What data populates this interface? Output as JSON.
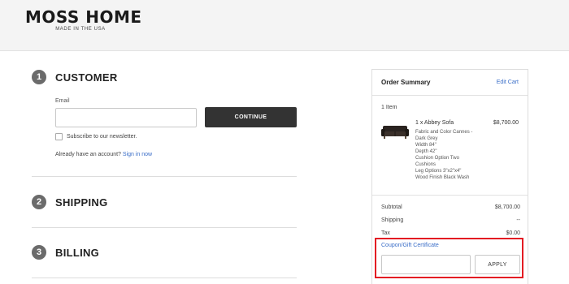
{
  "header": {
    "logo_main": "MOSS HOME",
    "logo_sub": "MADE IN THE USA"
  },
  "steps": [
    {
      "number": "1",
      "title": "CUSTOMER"
    },
    {
      "number": "2",
      "title": "SHIPPING"
    },
    {
      "number": "3",
      "title": "BILLING"
    }
  ],
  "customer": {
    "email_label": "Email",
    "email_value": "",
    "email_placeholder": "",
    "continue_label": "CONTINUE",
    "newsletter_label": "Subscribe to our newsletter.",
    "newsletter_checked": false,
    "account_prompt": "Already have an account?",
    "signin_label": "Sign in now"
  },
  "summary": {
    "title": "Order Summary",
    "edit_cart": "Edit Cart",
    "item_count": "1 Item",
    "product": {
      "name": "1 x Abbey Sofa",
      "price": "$8,700.00",
      "options": [
        "Fabric and Color Cannes -",
        "Dark Grey",
        "Width 84\"",
        "Depth 42\"",
        "Cushion Option Two",
        "Cushions",
        "Leg Options 3\"x2\"x4\"",
        "Wood Finish Black Wash"
      ]
    },
    "subtotal_label": "Subtotal",
    "subtotal_value": "$8,700.00",
    "shipping_label": "Shipping",
    "shipping_value": "--",
    "tax_label": "Tax",
    "tax_value": "$0.00",
    "coupon_link": "Coupon/Gift Certificate",
    "coupon_value": "",
    "apply_label": "APPLY"
  },
  "colors": {
    "accent_link": "#3a6ec8",
    "highlight_border": "#e31c23",
    "button_dark": "#333333"
  }
}
